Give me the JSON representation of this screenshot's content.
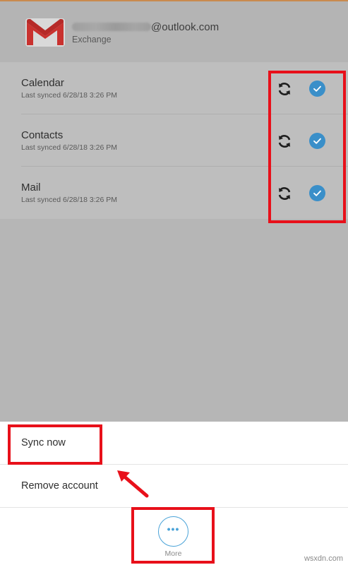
{
  "account": {
    "email_domain": "@outlook.com",
    "type": "Exchange",
    "logo_icon": "gmail-logo"
  },
  "sync_items": [
    {
      "label": "Calendar",
      "last_synced": "Last synced 6/28/18 3:26 PM",
      "sync_icon": "sync-icon",
      "checked": true
    },
    {
      "label": "Contacts",
      "last_synced": "Last synced 6/28/18 3:26 PM",
      "sync_icon": "sync-icon",
      "checked": true
    },
    {
      "label": "Mail",
      "last_synced": "Last synced 6/28/18 3:26 PM",
      "sync_icon": "sync-icon",
      "checked": true
    }
  ],
  "menu": {
    "sync_now": "Sync now",
    "remove_account": "Remove account"
  },
  "more": {
    "icon": "more-dots-icon",
    "label": "More"
  },
  "watermark": "wsxdn.com",
  "colors": {
    "accent_blue": "#3a8fc9",
    "highlight_red": "#e8101a",
    "overlay_gray": "#b6b6b6"
  }
}
